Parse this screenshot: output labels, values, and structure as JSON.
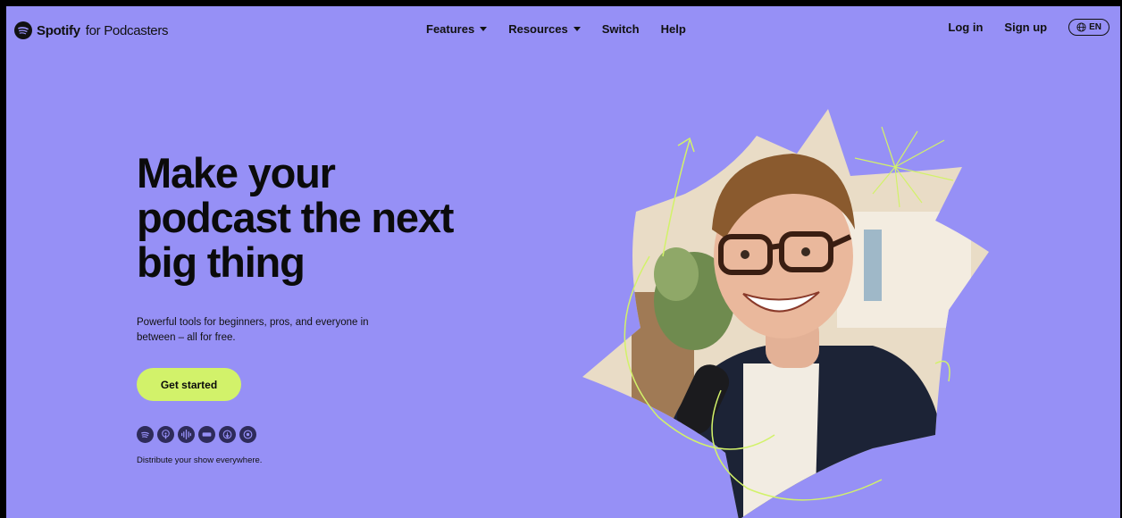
{
  "header": {
    "brand_name": "Spotify",
    "brand_tag": "for Podcasters",
    "nav": [
      {
        "label": "Features",
        "dropdown": true
      },
      {
        "label": "Resources",
        "dropdown": true
      },
      {
        "label": "Switch",
        "dropdown": false
      },
      {
        "label": "Help",
        "dropdown": false
      }
    ],
    "login": "Log in",
    "signup": "Sign up",
    "language": "EN"
  },
  "hero": {
    "headline": "Make your podcast the next big thing",
    "subtext": "Powerful tools for beginners, pros, and everyone in between – all for free.",
    "cta": "Get started",
    "platform_icons": [
      "spotify-icon",
      "podcasts-icon",
      "google-podcasts-icon",
      "stitcher-icon",
      "overcast-icon",
      "castbox-icon"
    ],
    "distribute": "Distribute your show everywhere."
  },
  "colors": {
    "background": "#9690f6",
    "accent": "#d2f26a",
    "text": "#0b0b0b"
  }
}
